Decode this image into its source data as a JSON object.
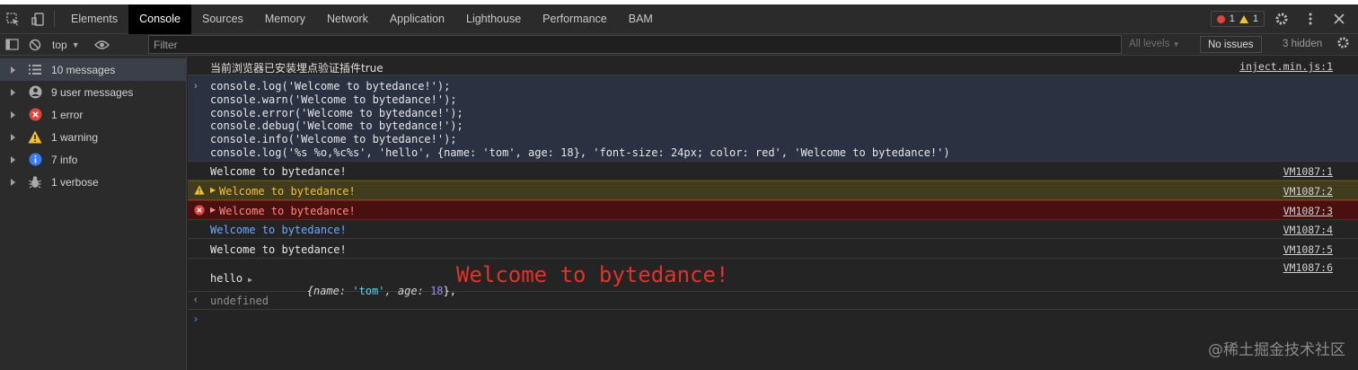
{
  "tabs": [
    {
      "label": "Elements"
    },
    {
      "label": "Console"
    },
    {
      "label": "Sources"
    },
    {
      "label": "Memory"
    },
    {
      "label": "Network"
    },
    {
      "label": "Application"
    },
    {
      "label": "Lighthouse"
    },
    {
      "label": "Performance"
    },
    {
      "label": "BAM"
    }
  ],
  "issue_counts": {
    "errors": "1",
    "warnings": "1"
  },
  "toolbar": {
    "context": "top",
    "filter_placeholder": "Filter",
    "levels": "All levels",
    "issues": "No issues",
    "hidden": "3 hidden"
  },
  "sidebar": {
    "items": [
      {
        "label": "10 messages",
        "icon": "list-icon"
      },
      {
        "label": "9 user messages",
        "icon": "user-icon"
      },
      {
        "label": "1 error",
        "icon": "error-icon"
      },
      {
        "label": "1 warning",
        "icon": "warning-icon"
      },
      {
        "label": "7 info",
        "icon": "info-icon"
      },
      {
        "label": "1 verbose",
        "icon": "bug-icon"
      }
    ]
  },
  "console": {
    "first_message": "当前浏览器已安装埋点验证插件true",
    "first_source": "inject.min.js:1",
    "input_lines": [
      "console.log('Welcome to bytedance!');",
      "console.warn('Welcome to bytedance!');",
      "console.error('Welcome to bytedance!');",
      "console.debug('Welcome to bytedance!');",
      "console.info('Welcome to bytedance!');",
      "console.log('%s %o,%c%s', 'hello', {name: 'tom', age: 18}, 'font-size: 24px; color: red', 'Welcome to bytedance!')"
    ],
    "outputs": [
      {
        "text": "Welcome to bytedance!",
        "source": "VM1087:1",
        "level": "log"
      },
      {
        "text": "Welcome to bytedance!",
        "source": "VM1087:2",
        "level": "warning"
      },
      {
        "text": "Welcome to bytedance!",
        "source": "VM1087:3",
        "level": "error"
      },
      {
        "text": "Welcome to bytedance!",
        "source": "VM1087:4",
        "level": "debug"
      },
      {
        "text": "Welcome to bytedance!",
        "source": "VM1087:5",
        "level": "info"
      }
    ],
    "formatted": {
      "prefix": "hello",
      "obj_open": "{",
      "name_key": "name",
      "name_value": "'tom'",
      "age_key": "age",
      "age_value": "18",
      "obj_close": "},",
      "styled_text": "Welcome to bytedance!",
      "source": "VM1087:6"
    },
    "return_value": "undefined"
  },
  "watermark": "@稀土掘金技术社区",
  "colors": {
    "warning_bg": "#413b1f",
    "error_bg": "#4a0f0f",
    "warning_text": "#f2c230",
    "error_text": "#ff8a80",
    "debug_text": "#6fa8ff",
    "styled_red": "#e5302a"
  }
}
